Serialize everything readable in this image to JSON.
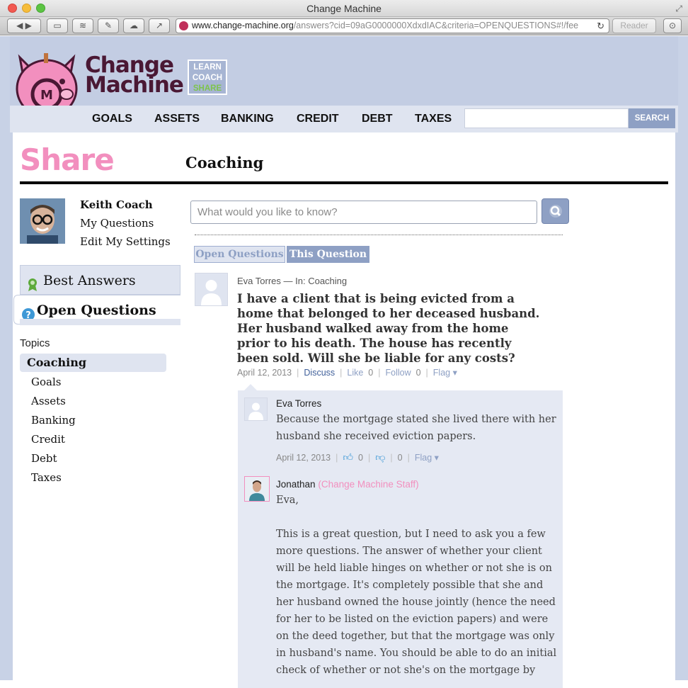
{
  "browser": {
    "window_title": "Change Machine",
    "url_host": "www.change-machine.org",
    "url_rest": "/answers?cid=09aG0000000XdxdIAC&criteria=OPENQUESTIONS#!/fee",
    "reader_label": "Reader"
  },
  "site": {
    "brand_line1": "Change",
    "brand_line2": "Machine",
    "learn": "LEARN",
    "coach": "COACH",
    "share": "SHARE",
    "nav": [
      "GOALS",
      "ASSETS",
      "BANKING",
      "CREDIT",
      "DEBT",
      "TAXES"
    ],
    "search_button": "SEARCH"
  },
  "page": {
    "section_title": "Share",
    "category_title": "Coaching"
  },
  "user": {
    "name": "Keith Coach",
    "links": [
      "My Questions",
      "Edit My Settings"
    ]
  },
  "sidebar": {
    "best_answers": "Best Answers",
    "open_questions": "Open Questions",
    "topics_heading": "Topics",
    "active_topic": "Coaching",
    "topics": [
      "Goals",
      "Assets",
      "Banking",
      "Credit",
      "Debt",
      "Taxes"
    ]
  },
  "search": {
    "placeholder": "What would you like to know?"
  },
  "tabs": {
    "open_questions": "Open Questions",
    "this_question": "This Question"
  },
  "question": {
    "author": "Eva Torres",
    "in_label": "— In: Coaching",
    "text": "I have a client that is being evicted from a home that belonged to her deceased husband. Her husband walked away from the home prior to his death. The house has recently been sold. Will she be liable for any costs?",
    "date": "April 12, 2013",
    "discuss": "Discuss",
    "like": "Like",
    "like_count": "0",
    "follow": "Follow",
    "follow_count": "0",
    "flag": "Flag ▾"
  },
  "answers": [
    {
      "author": "Eva Torres",
      "body": "Because the mortgage stated she lived there with her husband she received eviction papers.",
      "date": "April 12, 2013",
      "up_count": "0",
      "down_count": "0",
      "flag": "Flag ▾"
    },
    {
      "author": "Jonathan",
      "badge": "(Change Machine Staff)",
      "greeting": "Eva,",
      "body": "This is a great question, but I need to ask you a few more questions. The answer of whether your client will be held liable hinges on whether or not she is on the mortgage. It's completely possible that she and her husband owned the house jointly (hence the need for her to be listed on the eviction papers) and were on the deed together, but that the mortgage was only in husband's name. You should be able to do an initial check of whether or not she's on the mortgage by checking her"
    }
  ],
  "colors": {
    "accent_pink": "#f28fbe",
    "nav_blue": "#8ea0c4",
    "brand_purple": "#4a1834"
  }
}
